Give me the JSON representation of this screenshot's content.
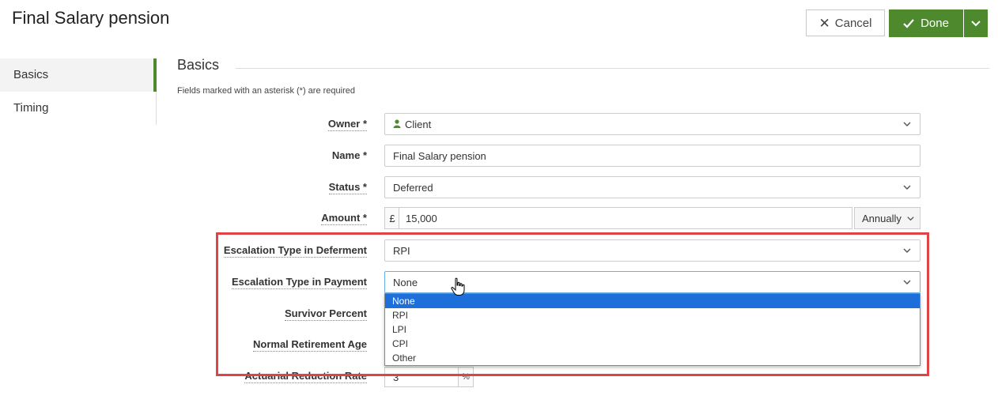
{
  "header": {
    "title": "Final Salary pension",
    "cancel_label": "Cancel",
    "done_label": "Done"
  },
  "sidebar": {
    "items": [
      {
        "label": "Basics",
        "active": true
      },
      {
        "label": "Timing",
        "active": false
      }
    ]
  },
  "section": {
    "title": "Basics",
    "required_note": "Fields marked with an asterisk (*) are required"
  },
  "form": {
    "owner": {
      "label": "Owner *",
      "value": "Client",
      "icon": "user-icon"
    },
    "name": {
      "label": "Name *",
      "value": "Final Salary pension"
    },
    "status": {
      "label": "Status *",
      "value": "Deferred"
    },
    "amount": {
      "label": "Amount *",
      "currency": "£",
      "value": "15,000",
      "frequency": "Annually"
    },
    "escalation_deferment": {
      "label": "Escalation Type in Deferment",
      "value": "RPI"
    },
    "escalation_payment": {
      "label": "Escalation Type in Payment",
      "value": "None",
      "options": [
        "None",
        "RPI",
        "LPI",
        "CPI",
        "Other"
      ],
      "selected_index": 0
    },
    "survivor_percent": {
      "label": "Survivor Percent"
    },
    "normal_retirement_age": {
      "label": "Normal Retirement Age"
    },
    "actuarial_reduction_rate": {
      "label": "Actuarial Reduction Rate",
      "value": "3",
      "suffix": "%"
    }
  },
  "colors": {
    "accent_green": "#4e8a2d",
    "highlight_red": "#e04345",
    "selection_blue": "#1e6fd9"
  }
}
